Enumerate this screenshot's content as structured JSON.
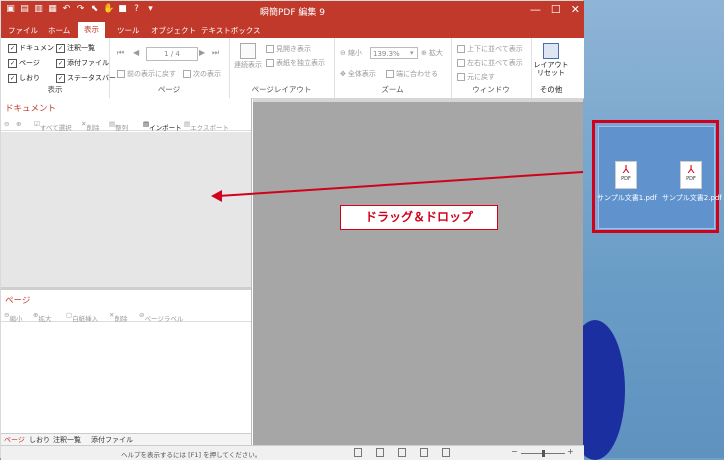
{
  "window": {
    "title": "瞬簡PDF 編集 9"
  },
  "menu": [
    {
      "label": "ファイル"
    },
    {
      "label": "ホーム"
    },
    {
      "label": "表示",
      "active": true
    },
    {
      "label": "ツール"
    },
    {
      "label": "オブジェクト"
    },
    {
      "label": "テキストボックス"
    }
  ],
  "ribbon": {
    "display": {
      "label": "表示",
      "checks": [
        "ドキュメント",
        "注釈一覧",
        "ページ",
        "添付ファイル",
        "しおり",
        "ステータスバー"
      ]
    },
    "page": {
      "label": "ページ",
      "page_indicator": "1 / 4",
      "prev_view": "前の表示に戻す",
      "next_view": "次の表示"
    },
    "layout": {
      "label": "ページレイアウト",
      "continuous": "連続表示",
      "spread": "見開き表示",
      "cover": "表紙を独立表示"
    },
    "zoom": {
      "label": "ズーム",
      "zoom_out": "縮小",
      "zoom_value": "139.3%",
      "zoom_in": "拡大",
      "fit_all": "全体表示",
      "fit_width": "端に合わせる"
    },
    "window": {
      "label": "ウィンドウ",
      "tile_vert": "上下に並べて表示",
      "tile_horz": "左右に並べて表示",
      "restore": "元に戻す"
    },
    "other": {
      "label": "その他",
      "reset": "レイアウト リセット"
    }
  },
  "document_pane": {
    "title": "ドキュメント",
    "select_all": "すべて選択",
    "delete": "削除",
    "sort": "整列",
    "import": "インポート",
    "export": "エクスポート"
  },
  "page_pane": {
    "title": "ページ",
    "shrink": "縮小",
    "enlarge": "拡大",
    "insert_blank": "白紙挿入",
    "delete": "削除",
    "page_label": "ページラベル"
  },
  "bottom_tabs": [
    "ページ",
    "しおり",
    "注釈一覧",
    "添付ファイル"
  ],
  "status": {
    "help": "ヘルプを表示するには [F1] を押してください。"
  },
  "explorer": {
    "files": [
      "サンプル文書1.pdf",
      "サンプル文書2.pdf"
    ],
    "icon_text": "PDF"
  },
  "annotation": {
    "label": "ドラッグ＆ドロップ"
  },
  "colors": {
    "accent": "#c0392b",
    "annotation": "#d0021b"
  }
}
